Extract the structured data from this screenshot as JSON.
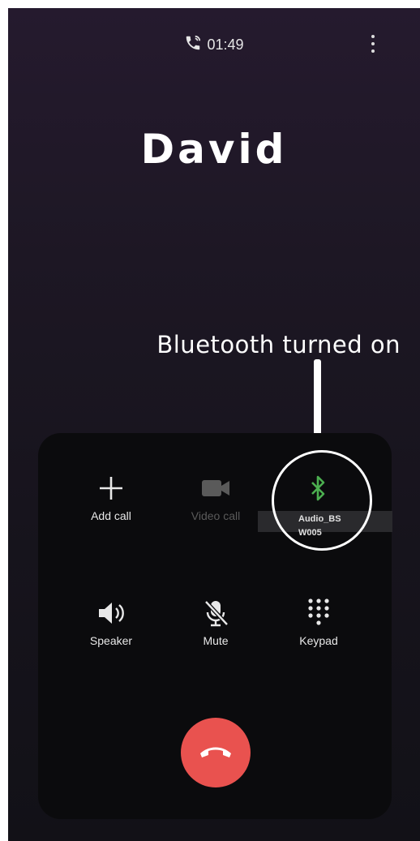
{
  "status": {
    "call_timer": "01:49"
  },
  "caller": {
    "name": "David"
  },
  "annotation": {
    "text": "Bluetooth turned on"
  },
  "controls": {
    "add_call": "Add call",
    "video_call": "Video call",
    "bluetooth_device_line1": "Audio_BS",
    "bluetooth_device_line2": "W005",
    "speaker": "Speaker",
    "mute": "Mute",
    "keypad": "Keypad"
  },
  "colors": {
    "bluetooth_active": "#4caf50",
    "end_call": "#e9524f",
    "panel": "#0b0b0d"
  },
  "icons": [
    "call-icon",
    "more-options-icon",
    "plus-icon",
    "video-icon",
    "bluetooth-icon",
    "speaker-icon",
    "mute-icon",
    "keypad-icon",
    "end-call-icon"
  ]
}
